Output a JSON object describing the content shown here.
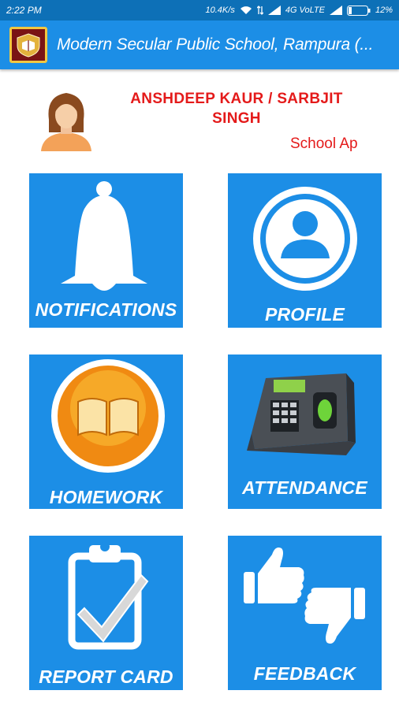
{
  "status_bar": {
    "time": "2:22 PM",
    "network_speed": "10.4K/s",
    "network_type": "4G VoLTE",
    "battery": "12%",
    "icons": [
      "wifi-icon",
      "data-arrows-icon",
      "signal-icon",
      "signal-icon",
      "battery-icon"
    ]
  },
  "app_bar": {
    "title": "Modern Secular Public School, Rampura (...",
    "logo_icon": "school-crest-icon"
  },
  "user": {
    "name": "ANSHDEEP KAUR / SARBJIT SINGH",
    "subtitle": "School Ap",
    "avatar_icon": "female-avatar-icon"
  },
  "colors": {
    "status_bar": "#0d70b7",
    "app_bar": "#1c8ee6",
    "tile": "#1c8ee6",
    "user_text": "#e41a1a"
  },
  "tiles": [
    {
      "label": "NOTIFICATIONS",
      "icon": "bell-icon"
    },
    {
      "label": "PROFILE",
      "icon": "profile-icon"
    },
    {
      "label": "HOMEWORK",
      "icon": "book-icon"
    },
    {
      "label": "ATTENDANCE",
      "icon": "biometric-machine-icon"
    },
    {
      "label": "REPORT CARD",
      "icon": "clipboard-check-icon"
    },
    {
      "label": "FEEDBACK",
      "icon": "thumbs-up-down-icon"
    }
  ]
}
